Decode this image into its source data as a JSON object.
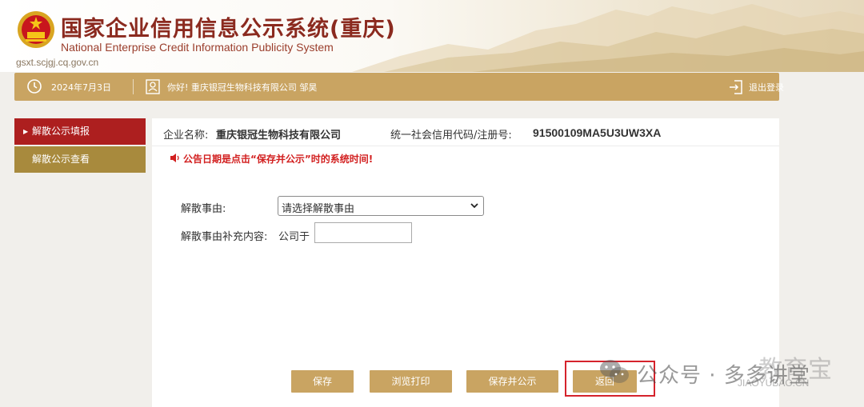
{
  "header": {
    "title_cn": "国家企业信用信息公示系统(重庆)",
    "title_en": "National Enterprise Credit Information Publicity System",
    "url": "gsxt.scjgj.cq.gov.cn"
  },
  "topbar": {
    "date": "2024年7月3日",
    "greeting": "你好! 重庆银冠生物科技有限公司 邹昊",
    "logout": "退出登录"
  },
  "sidebar": {
    "items": [
      {
        "label": "解散公示填报",
        "active": true
      },
      {
        "label": "解散公示查看",
        "active": false
      }
    ]
  },
  "main": {
    "company_label": "企业名称:",
    "company_name": "重庆银冠生物科技有限公司",
    "code_label": "统一社会信用代码/注册号:",
    "code_value": "91500109MA5U3UW3XA",
    "notice": "公告日期是点击“保存并公示”时的系统时间!",
    "form": {
      "reason_label": "解散事由:",
      "reason_select": "请选择解散事由",
      "supplement_label": "解散事由补充内容:",
      "supplement_prefix": "公司于",
      "supplement_value": ""
    },
    "buttons": {
      "save": "保存",
      "preview_print": "浏览打印",
      "save_publish": "保存并公示",
      "back": "返回"
    }
  },
  "watermark": {
    "text": "公众号 · 多多讲堂",
    "overlay": "教育宝",
    "sub": "JIAOYUBAO.CN"
  },
  "colors": {
    "gold": "#c9a462",
    "menu_active": "#ad1f1f",
    "menu_normal": "#a88a3d",
    "title": "#8b2a1f",
    "notice": "#d21f1f",
    "highlight_box": "#d5232c"
  }
}
